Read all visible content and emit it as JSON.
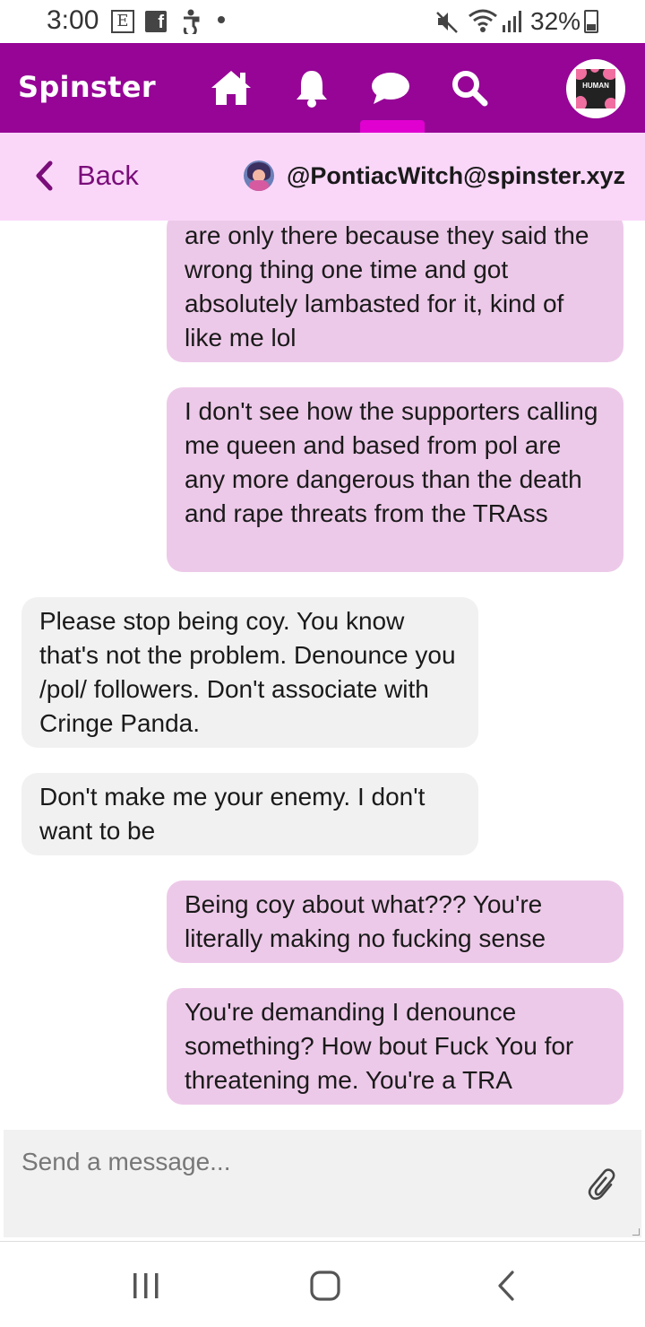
{
  "status_bar": {
    "time": "3:00",
    "icons": [
      "e-notification-icon",
      "facebook-icon",
      "accessibility-icon",
      "dot-icon",
      "mute-icon",
      "wifi-icon",
      "signal-icon",
      "battery-icon"
    ],
    "e_glyph": "E",
    "f_glyph": "f",
    "battery": "32%",
    "battery_level": 0.32
  },
  "navbar": {
    "brand": "Spinster",
    "background": "#960596",
    "accent": "#e000d0",
    "items": [
      {
        "name": "home-icon"
      },
      {
        "name": "bell-icon"
      },
      {
        "name": "chat-icon",
        "active": true
      },
      {
        "name": "search-icon"
      }
    ],
    "avatar_text": "HUMAN"
  },
  "conversation_header": {
    "back_label": "Back",
    "peer_handle": "@PontiacWitch@spinster.xyz",
    "background": "#fad7f9"
  },
  "messages": [
    {
      "direction": "out",
      "text": "are only there because they said the wrong thing one time and got absolutely lambasted for it, kind of like me lol"
    },
    {
      "direction": "out",
      "text": "I don't see how the supporters calling me queen and based from pol are any more dangerous than the death and rape threats from the TRAss"
    },
    {
      "direction": "in",
      "text": "Please stop being coy. You know that's not the problem.  Denounce you /pol/ followers. Don't associate with Cringe Panda."
    },
    {
      "direction": "in",
      "text": "Don't make me your enemy. I don't want to be"
    },
    {
      "direction": "out",
      "text": "Being coy about what??? You're literally making no fucking sense"
    },
    {
      "direction": "out",
      "text": "You're demanding I denounce something? How bout Fuck You for threatening me. You're a TRA"
    }
  ],
  "composer": {
    "placeholder": "Send a message...",
    "value": ""
  },
  "colors": {
    "outgoing_bubble": "#edc9e9",
    "incoming_bubble": "#f1f1f1"
  }
}
